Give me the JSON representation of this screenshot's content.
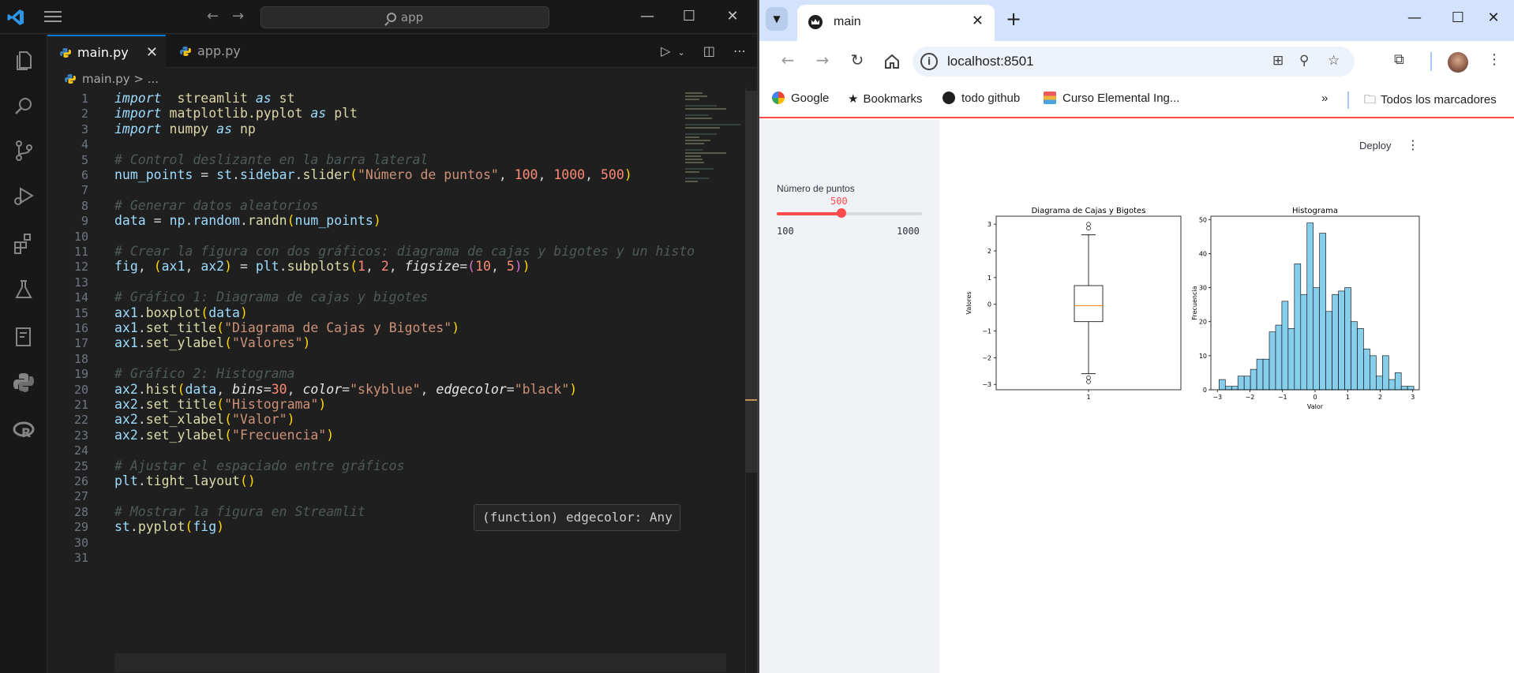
{
  "vscode": {
    "search_text": "app",
    "tabs": [
      {
        "label": "main.py",
        "active": true
      },
      {
        "label": "app.py",
        "active": false
      }
    ],
    "breadcrumb": "main.py",
    "breadcrumb_rest": " > ...",
    "tooltip": "(function) edgecolor: Any",
    "code_lines": [
      {
        "n": "1",
        "segs": [
          [
            "kw",
            "import"
          ],
          [
            "",
            "  "
          ],
          [
            "mod",
            "streamlit"
          ],
          [
            "",
            " "
          ],
          [
            "kw",
            "as"
          ],
          [
            "",
            " "
          ],
          [
            "mod",
            "st"
          ]
        ]
      },
      {
        "n": "2",
        "segs": [
          [
            "kw",
            "import"
          ],
          [
            "",
            " "
          ],
          [
            "mod",
            "matplotlib.pyplot"
          ],
          [
            "",
            " "
          ],
          [
            "kw",
            "as"
          ],
          [
            "",
            " "
          ],
          [
            "mod",
            "plt"
          ]
        ]
      },
      {
        "n": "3",
        "segs": [
          [
            "kw",
            "import"
          ],
          [
            "",
            " "
          ],
          [
            "mod",
            "numpy"
          ],
          [
            "",
            " "
          ],
          [
            "kw",
            "as"
          ],
          [
            "",
            " "
          ],
          [
            "mod",
            "np"
          ]
        ]
      },
      {
        "n": "4",
        "segs": []
      },
      {
        "n": "5",
        "segs": [
          [
            "cm",
            "# Control deslizante en la barra lateral"
          ]
        ]
      },
      {
        "n": "6",
        "segs": [
          [
            "id",
            "num_points"
          ],
          [
            "",
            " = "
          ],
          [
            "id",
            "st"
          ],
          [
            "",
            "."
          ],
          [
            "id",
            "sidebar"
          ],
          [
            "",
            "."
          ],
          [
            "fn",
            "slider"
          ],
          [
            "par",
            "("
          ],
          [
            "str",
            "\"Número de puntos\""
          ],
          [
            "",
            ", "
          ],
          [
            "num2",
            "100"
          ],
          [
            "",
            ", "
          ],
          [
            "num2",
            "1000"
          ],
          [
            "",
            ", "
          ],
          [
            "num2",
            "500"
          ],
          [
            "par",
            ")"
          ]
        ]
      },
      {
        "n": "7",
        "segs": []
      },
      {
        "n": "8",
        "segs": [
          [
            "cm",
            "# Generar datos aleatorios"
          ]
        ]
      },
      {
        "n": "9",
        "segs": [
          [
            "id",
            "data"
          ],
          [
            "",
            " = "
          ],
          [
            "id",
            "np"
          ],
          [
            "",
            "."
          ],
          [
            "id",
            "random"
          ],
          [
            "",
            "."
          ],
          [
            "fn",
            "randn"
          ],
          [
            "par",
            "("
          ],
          [
            "id",
            "num_points"
          ],
          [
            "par",
            ")"
          ]
        ]
      },
      {
        "n": "10",
        "segs": []
      },
      {
        "n": "11",
        "segs": [
          [
            "cm",
            "# Crear la figura con dos gráficos: diagrama de cajas y bigotes y un histo"
          ]
        ]
      },
      {
        "n": "12",
        "segs": [
          [
            "id",
            "fig"
          ],
          [
            "",
            ", "
          ],
          [
            "par",
            "("
          ],
          [
            "id",
            "ax1"
          ],
          [
            "",
            ", "
          ],
          [
            "id",
            "ax2"
          ],
          [
            "par",
            ")"
          ],
          [
            "",
            " = "
          ],
          [
            "id",
            "plt"
          ],
          [
            "",
            "."
          ],
          [
            "fn",
            "subplots"
          ],
          [
            "par",
            "("
          ],
          [
            "num2",
            "1"
          ],
          [
            "",
            ", "
          ],
          [
            "num2",
            "2"
          ],
          [
            "",
            ", "
          ],
          [
            "kwarg",
            "figsize"
          ],
          [
            "",
            "="
          ],
          [
            "par2",
            "("
          ],
          [
            "num2",
            "10"
          ],
          [
            "",
            ", "
          ],
          [
            "num2",
            "5"
          ],
          [
            "par2",
            ")"
          ],
          [
            "par",
            ")"
          ]
        ]
      },
      {
        "n": "13",
        "segs": []
      },
      {
        "n": "14",
        "segs": [
          [
            "cm",
            "# Gráfico 1: Diagrama de cajas y bigotes"
          ]
        ]
      },
      {
        "n": "15",
        "segs": [
          [
            "id",
            "ax1"
          ],
          [
            "",
            "."
          ],
          [
            "fn",
            "boxplot"
          ],
          [
            "par",
            "("
          ],
          [
            "id",
            "data"
          ],
          [
            "par",
            ")"
          ]
        ]
      },
      {
        "n": "16",
        "segs": [
          [
            "id",
            "ax1"
          ],
          [
            "",
            "."
          ],
          [
            "fn",
            "set_title"
          ],
          [
            "par",
            "("
          ],
          [
            "str",
            "\"Diagrama de Cajas y Bigotes\""
          ],
          [
            "par",
            ")"
          ]
        ]
      },
      {
        "n": "17",
        "segs": [
          [
            "id",
            "ax1"
          ],
          [
            "",
            "."
          ],
          [
            "fn",
            "set_ylabel"
          ],
          [
            "par",
            "("
          ],
          [
            "str",
            "\"Valores\""
          ],
          [
            "par",
            ")"
          ]
        ]
      },
      {
        "n": "18",
        "segs": []
      },
      {
        "n": "19",
        "segs": [
          [
            "cm",
            "# Gráfico 2: Histograma"
          ]
        ]
      },
      {
        "n": "20",
        "segs": [
          [
            "id",
            "ax2"
          ],
          [
            "",
            "."
          ],
          [
            "fn",
            "hist"
          ],
          [
            "par",
            "("
          ],
          [
            "id",
            "data"
          ],
          [
            "",
            ", "
          ],
          [
            "kwarg",
            "bins"
          ],
          [
            "",
            "="
          ],
          [
            "num2",
            "30"
          ],
          [
            "",
            ", "
          ],
          [
            "kwarg",
            "color"
          ],
          [
            "",
            "="
          ],
          [
            "str",
            "\"skyblue\""
          ],
          [
            "",
            ", "
          ],
          [
            "kwarg",
            "edgecolor"
          ],
          [
            "",
            "="
          ],
          [
            "str",
            "\"black\""
          ],
          [
            "par",
            ")"
          ]
        ]
      },
      {
        "n": "21",
        "segs": [
          [
            "id",
            "ax2"
          ],
          [
            "",
            "."
          ],
          [
            "fn",
            "set_title"
          ],
          [
            "par",
            "("
          ],
          [
            "str",
            "\"Histograma\""
          ],
          [
            "par",
            ")"
          ]
        ]
      },
      {
        "n": "22",
        "segs": [
          [
            "id",
            "ax2"
          ],
          [
            "",
            "."
          ],
          [
            "fn",
            "set_xlabel"
          ],
          [
            "par",
            "("
          ],
          [
            "str",
            "\"Valor\""
          ],
          [
            "par",
            ")"
          ]
        ]
      },
      {
        "n": "23",
        "segs": [
          [
            "id",
            "ax2"
          ],
          [
            "",
            "."
          ],
          [
            "fn",
            "set_ylabel"
          ],
          [
            "par",
            "("
          ],
          [
            "str",
            "\"Frecuencia\""
          ],
          [
            "par",
            ")"
          ]
        ]
      },
      {
        "n": "24",
        "segs": []
      },
      {
        "n": "25",
        "segs": [
          [
            "cm",
            "# Ajustar el espaciado entre gráficos"
          ]
        ]
      },
      {
        "n": "26",
        "segs": [
          [
            "id",
            "plt"
          ],
          [
            "",
            "."
          ],
          [
            "fn",
            "tight_layout"
          ],
          [
            "par",
            "()"
          ]
        ]
      },
      {
        "n": "27",
        "segs": []
      },
      {
        "n": "28",
        "segs": [
          [
            "cm",
            "# Mostrar la figura en Streamlit"
          ]
        ]
      },
      {
        "n": "29",
        "segs": [
          [
            "id",
            "st"
          ],
          [
            "",
            "."
          ],
          [
            "fn",
            "pyplot"
          ],
          [
            "par",
            "("
          ],
          [
            "id",
            "fig"
          ],
          [
            "par",
            ")"
          ]
        ]
      },
      {
        "n": "30",
        "segs": []
      },
      {
        "n": "31",
        "segs": []
      }
    ]
  },
  "chrome": {
    "tab_title": "main",
    "url": "localhost:8501",
    "bookmarks": [
      "Google",
      "Bookmarks",
      "todo github",
      "Curso Elemental Ing...",
      "Todos los marcadores"
    ]
  },
  "streamlit": {
    "deploy_label": "Deploy",
    "slider": {
      "label": "Número de puntos",
      "value": "500",
      "min": "100",
      "max": "1000",
      "fraction": 0.444
    }
  },
  "chart_data": [
    {
      "type": "box",
      "title": "Diagrama de Cajas y Bigotes",
      "ylabel": "Valores",
      "categories": [
        "1"
      ],
      "ylim": [
        -3.2,
        3.3
      ],
      "yticks": [
        -3,
        -2,
        -1,
        0,
        1,
        2,
        3
      ],
      "stats": {
        "q1": -0.65,
        "median": -0.05,
        "q3": 0.7,
        "whisker_low": -2.6,
        "whisker_high": 2.6
      },
      "outliers": [
        2.85,
        3.0,
        -2.75,
        -2.9
      ],
      "colors": {
        "median": "#ff7f0e",
        "box": "#000000"
      }
    },
    {
      "type": "bar",
      "title": "Histograma",
      "xlabel": "Valor",
      "ylabel": "Frecuencia",
      "xlim": [
        -3.2,
        3.2
      ],
      "ylim": [
        0,
        51
      ],
      "xticks": [
        -3,
        -2,
        -1,
        0,
        1,
        2,
        3
      ],
      "yticks": [
        0,
        10,
        20,
        30,
        40,
        50
      ],
      "bin_start": -2.95,
      "bin_width": 0.193,
      "values": [
        3,
        1,
        1,
        4,
        4,
        6,
        9,
        9,
        17,
        19,
        26,
        18,
        37,
        28,
        49,
        30,
        46,
        23,
        28,
        29,
        30,
        20,
        18,
        12,
        10,
        4,
        10,
        3,
        5,
        1,
        1
      ],
      "colors": {
        "fill": "#87ceeb",
        "edge": "#000000"
      }
    }
  ]
}
